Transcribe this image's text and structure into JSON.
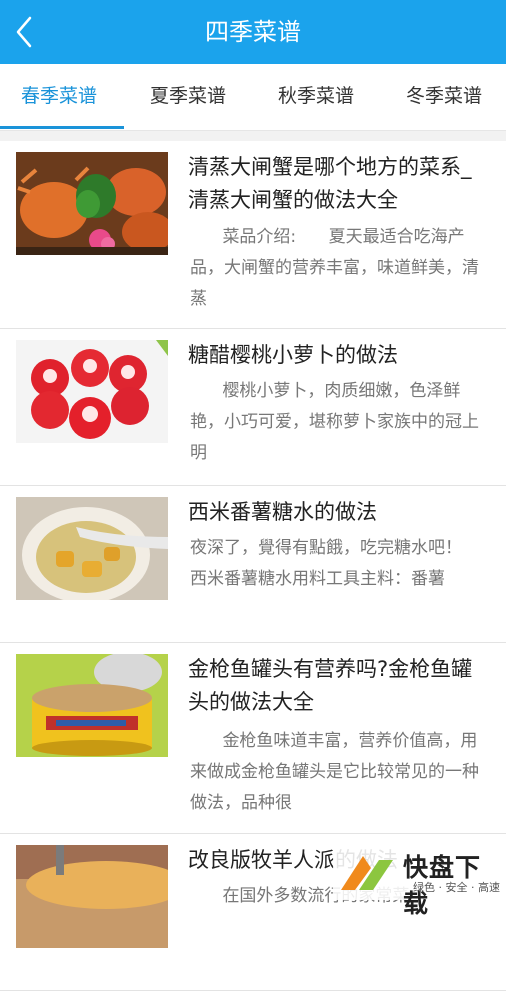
{
  "header": {
    "title": "四季菜谱",
    "back_icon": "chevron-left-icon"
  },
  "tabs": [
    {
      "label": "春季菜谱",
      "active": true
    },
    {
      "label": "夏季菜谱",
      "active": false
    },
    {
      "label": "秋季菜谱",
      "active": false
    },
    {
      "label": "冬季菜谱",
      "active": false
    }
  ],
  "colors": {
    "header_bg": "#1ba3ec",
    "active_tab": "#1a93d9",
    "text_primary": "#222222",
    "text_secondary": "#777777"
  },
  "recipes": [
    {
      "title": "清蒸大闸蟹是哪个地方的菜系_清蒸大闸蟹的做法大全",
      "description": "      菜品介绍:      夏天最适合吃海产品，大闸蟹的营养丰富，味道鲜美，清蒸",
      "image": "steamed-crab-image"
    },
    {
      "title": "糖醋樱桃小萝卜的做法",
      "description": "      樱桃小萝卜，肉质细嫩，色泽鲜艳，小巧可爱，堪称萝卜家族中的冠上明",
      "image": "radish-image"
    },
    {
      "title": "西米番薯糖水的做法",
      "description": "夜深了，覺得有點餓，吃完糖水吧！      西米番薯糖水用料工具主料：番薯",
      "image": "sweet-potato-soup-image"
    },
    {
      "title": "金枪鱼罐头有营养吗?金枪鱼罐头的做法大全",
      "description": "      金枪鱼味道丰富，营养价值高，用来做成金枪鱼罐头是它比较常见的一种做法，品种很",
      "image": "tuna-can-image"
    },
    {
      "title": "改良版牧羊人派的做法",
      "description": "      在国外多数流行的家常菜",
      "image": "shepherd-pie-image"
    }
  ],
  "watermark": {
    "main": "快盘下载",
    "sub": "绿色 · 安全 · 高速"
  }
}
